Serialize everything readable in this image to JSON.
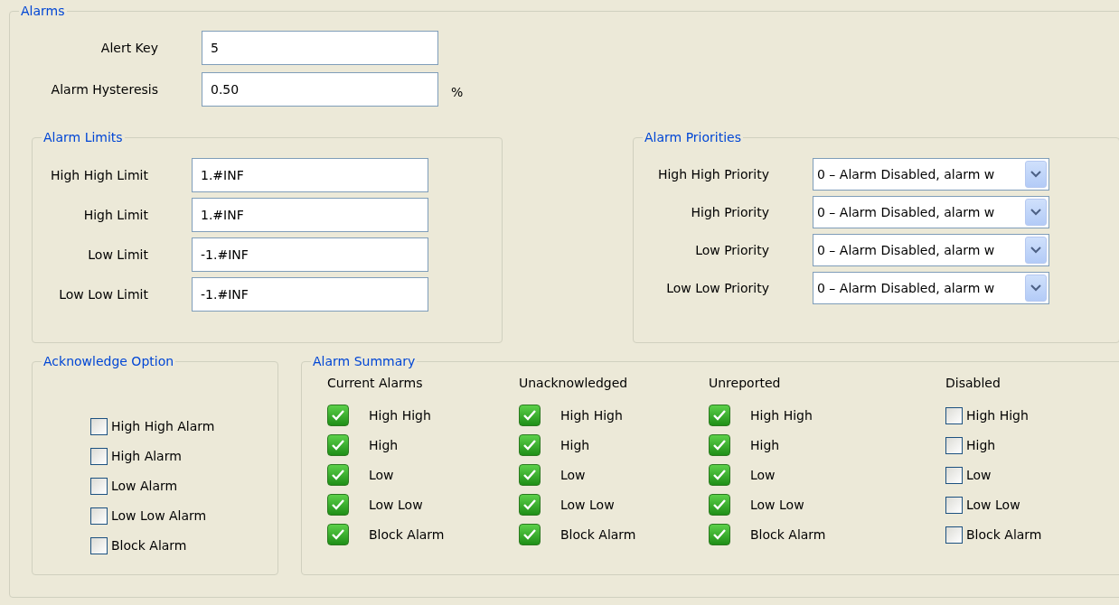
{
  "group": {
    "title": "Alarms"
  },
  "fields": [
    {
      "label": "Alert Key",
      "value": "5"
    },
    {
      "label": "Alarm Hysteresis",
      "value": "0.50",
      "unit": "%"
    }
  ],
  "alarm_limits": {
    "title": "Alarm Limits",
    "rows": [
      {
        "label": "High High Limit",
        "value": "1.#INF"
      },
      {
        "label": "High Limit",
        "value": "1.#INF"
      },
      {
        "label": "Low Limit",
        "value": "-1.#INF"
      },
      {
        "label": "Low Low Limit",
        "value": "-1.#INF"
      }
    ]
  },
  "alarm_priorities": {
    "title": "Alarm Priorities",
    "rows": [
      {
        "label": "High High Priority",
        "value": "0 – Alarm Disabled, alarm w"
      },
      {
        "label": "High Priority",
        "value": "0 – Alarm Disabled, alarm w"
      },
      {
        "label": "Low Priority",
        "value": "0 – Alarm Disabled, alarm w"
      },
      {
        "label": "Low Low Priority",
        "value": "0 – Alarm Disabled, alarm w"
      }
    ]
  },
  "acknowledge_option": {
    "title": "Acknowledge Option",
    "items": [
      {
        "label": "High High Alarm",
        "checked": false
      },
      {
        "label": "High Alarm",
        "checked": false
      },
      {
        "label": "Low Alarm",
        "checked": false
      },
      {
        "label": "Low Low Alarm",
        "checked": false
      },
      {
        "label": "Block Alarm",
        "checked": false
      }
    ]
  },
  "alarm_summary": {
    "title": "Alarm Summary",
    "columns": [
      {
        "heading": "Current Alarms",
        "kind": "indicator",
        "items": [
          {
            "label": "High High",
            "checked": true
          },
          {
            "label": "High",
            "checked": true
          },
          {
            "label": "Low",
            "checked": true
          },
          {
            "label": "Low Low",
            "checked": true
          },
          {
            "label": "Block Alarm",
            "checked": true
          }
        ]
      },
      {
        "heading": "Unacknowledged",
        "kind": "indicator",
        "items": [
          {
            "label": "High High",
            "checked": true
          },
          {
            "label": "High",
            "checked": true
          },
          {
            "label": "Low",
            "checked": true
          },
          {
            "label": "Low Low",
            "checked": true
          },
          {
            "label": "Block Alarm",
            "checked": true
          }
        ]
      },
      {
        "heading": "Unreported",
        "kind": "indicator",
        "items": [
          {
            "label": "High High",
            "checked": true
          },
          {
            "label": "High",
            "checked": true
          },
          {
            "label": "Low",
            "checked": true
          },
          {
            "label": "Low Low",
            "checked": true
          },
          {
            "label": "Block Alarm",
            "checked": true
          }
        ]
      },
      {
        "heading": "Disabled",
        "kind": "checkbox",
        "items": [
          {
            "label": "High High",
            "checked": false
          },
          {
            "label": "High",
            "checked": false
          },
          {
            "label": "Low",
            "checked": false
          },
          {
            "label": "Low Low",
            "checked": false
          },
          {
            "label": "Block Alarm",
            "checked": false
          }
        ]
      }
    ]
  }
}
